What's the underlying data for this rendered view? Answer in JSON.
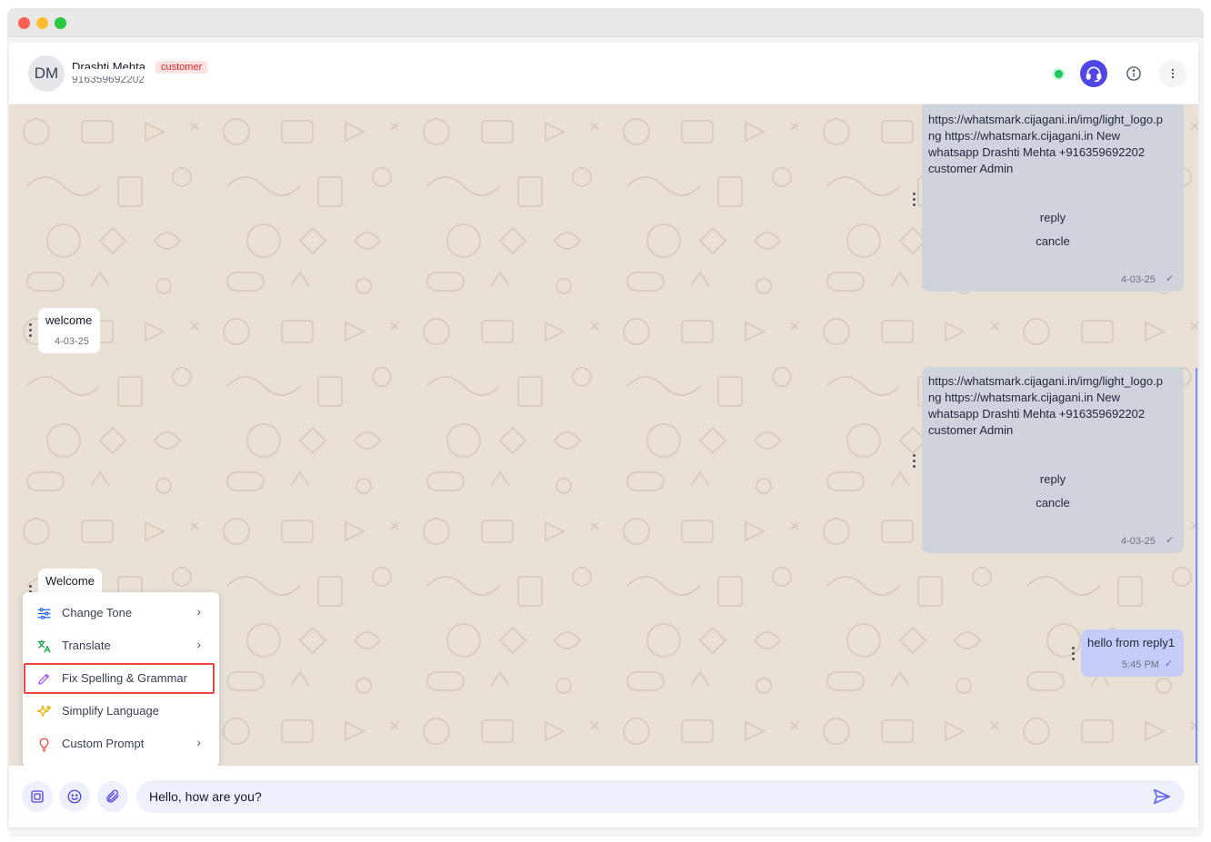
{
  "contact": {
    "initials": "DM",
    "name": "Drashti Mehta",
    "phone": "916359692202",
    "badge": "customer"
  },
  "messages": {
    "out1": {
      "text": "https://whatsmark.cijagani.in/img/light_logo.png https://whatsmark.cijagani.in New whatsapp Drashti Mehta +916359692202 customer Admin",
      "line1": "https://whatsmark.cijagani.in/img/light_logo.p",
      "line2": "ng https://whatsmark.cijagani.in New",
      "line3": "whatsapp Drashti Mehta +916359692202",
      "line4": "customer Admin",
      "button1": "reply",
      "button2": "cancle",
      "time": "4-03-25"
    },
    "in1": {
      "text": "welcome",
      "time": "4-03-25"
    },
    "out2": {
      "line1": "https://whatsmark.cijagani.in/img/light_logo.p",
      "line2": "ng https://whatsmark.cijagani.in New",
      "line3": "whatsapp Drashti Mehta +916359692202",
      "line4": "customer Admin",
      "button1": "reply",
      "button2": "cancle",
      "time": "4-03-25"
    },
    "in2": {
      "text": "Welcome"
    },
    "out3": {
      "text": "hello from reply1",
      "time": "5:45 PM"
    }
  },
  "ai_menu": {
    "items": [
      {
        "label": "Change Tone",
        "icon": "sliders-icon",
        "has_submenu": true
      },
      {
        "label": "Translate",
        "icon": "translate-icon",
        "has_submenu": true
      },
      {
        "label": "Fix Spelling & Grammar",
        "icon": "pencil-icon",
        "has_submenu": false,
        "highlighted": true
      },
      {
        "label": "Simplify Language",
        "icon": "sparkles-icon",
        "has_submenu": false
      },
      {
        "label": "Custom Prompt",
        "icon": "lightbulb-icon",
        "has_submenu": true
      }
    ]
  },
  "composer": {
    "value": "Hello, how are you?"
  },
  "colors": {
    "accent": "#4f46e5",
    "online": "#22c55e",
    "badge_text": "#dc2626",
    "highlight_border": "#ef4444",
    "chat_bg": "#e9e0d6",
    "outgoing_bubble": "#cfd3db",
    "outgoing_bubble_blue": "#c7cbf7"
  }
}
